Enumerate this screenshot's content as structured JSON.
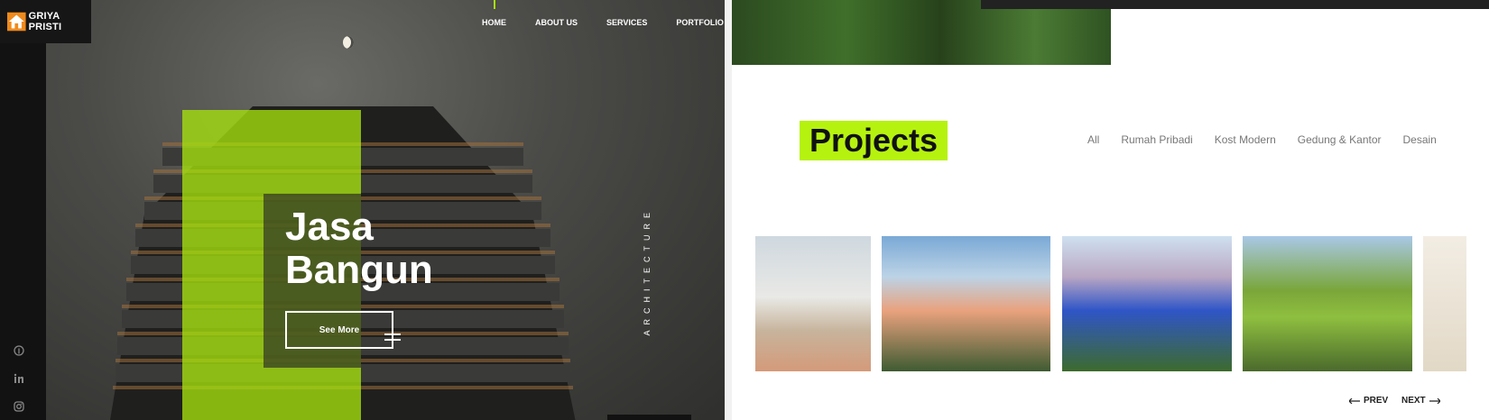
{
  "brand": {
    "name": "GRIYA PRISTI",
    "accent": "#a6e10a"
  },
  "nav": {
    "items": [
      "HOME",
      "ABOUT US",
      "SERVICES",
      "PORTFOLIO"
    ]
  },
  "hero": {
    "title_line1": "Jasa",
    "title_line2": "Bangun",
    "button_label": "See More",
    "vertical_label": "ARCHITECTURE"
  },
  "social": {
    "icons": [
      "pinterest-icon",
      "linkedin-icon",
      "instagram-icon"
    ]
  },
  "projects": {
    "title": "Projects",
    "filters": [
      "All",
      "Rumah Pribadi",
      "Kost Modern",
      "Gedung & Kantor",
      "Desain"
    ],
    "prev_label": "PREV",
    "next_label": "NEXT"
  }
}
